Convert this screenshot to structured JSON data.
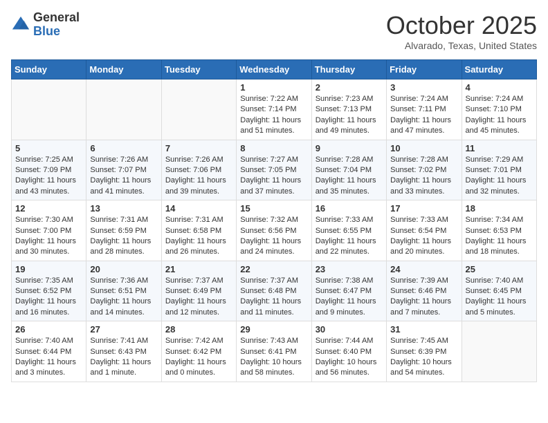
{
  "header": {
    "logo_general": "General",
    "logo_blue": "Blue",
    "month_title": "October 2025",
    "location": "Alvarado, Texas, United States"
  },
  "days_of_week": [
    "Sunday",
    "Monday",
    "Tuesday",
    "Wednesday",
    "Thursday",
    "Friday",
    "Saturday"
  ],
  "weeks": [
    [
      {
        "day": "",
        "content": ""
      },
      {
        "day": "",
        "content": ""
      },
      {
        "day": "",
        "content": ""
      },
      {
        "day": "1",
        "content": "Sunrise: 7:22 AM\nSunset: 7:14 PM\nDaylight: 11 hours and 51 minutes."
      },
      {
        "day": "2",
        "content": "Sunrise: 7:23 AM\nSunset: 7:13 PM\nDaylight: 11 hours and 49 minutes."
      },
      {
        "day": "3",
        "content": "Sunrise: 7:24 AM\nSunset: 7:11 PM\nDaylight: 11 hours and 47 minutes."
      },
      {
        "day": "4",
        "content": "Sunrise: 7:24 AM\nSunset: 7:10 PM\nDaylight: 11 hours and 45 minutes."
      }
    ],
    [
      {
        "day": "5",
        "content": "Sunrise: 7:25 AM\nSunset: 7:09 PM\nDaylight: 11 hours and 43 minutes."
      },
      {
        "day": "6",
        "content": "Sunrise: 7:26 AM\nSunset: 7:07 PM\nDaylight: 11 hours and 41 minutes."
      },
      {
        "day": "7",
        "content": "Sunrise: 7:26 AM\nSunset: 7:06 PM\nDaylight: 11 hours and 39 minutes."
      },
      {
        "day": "8",
        "content": "Sunrise: 7:27 AM\nSunset: 7:05 PM\nDaylight: 11 hours and 37 minutes."
      },
      {
        "day": "9",
        "content": "Sunrise: 7:28 AM\nSunset: 7:04 PM\nDaylight: 11 hours and 35 minutes."
      },
      {
        "day": "10",
        "content": "Sunrise: 7:28 AM\nSunset: 7:02 PM\nDaylight: 11 hours and 33 minutes."
      },
      {
        "day": "11",
        "content": "Sunrise: 7:29 AM\nSunset: 7:01 PM\nDaylight: 11 hours and 32 minutes."
      }
    ],
    [
      {
        "day": "12",
        "content": "Sunrise: 7:30 AM\nSunset: 7:00 PM\nDaylight: 11 hours and 30 minutes."
      },
      {
        "day": "13",
        "content": "Sunrise: 7:31 AM\nSunset: 6:59 PM\nDaylight: 11 hours and 28 minutes."
      },
      {
        "day": "14",
        "content": "Sunrise: 7:31 AM\nSunset: 6:58 PM\nDaylight: 11 hours and 26 minutes."
      },
      {
        "day": "15",
        "content": "Sunrise: 7:32 AM\nSunset: 6:56 PM\nDaylight: 11 hours and 24 minutes."
      },
      {
        "day": "16",
        "content": "Sunrise: 7:33 AM\nSunset: 6:55 PM\nDaylight: 11 hours and 22 minutes."
      },
      {
        "day": "17",
        "content": "Sunrise: 7:33 AM\nSunset: 6:54 PM\nDaylight: 11 hours and 20 minutes."
      },
      {
        "day": "18",
        "content": "Sunrise: 7:34 AM\nSunset: 6:53 PM\nDaylight: 11 hours and 18 minutes."
      }
    ],
    [
      {
        "day": "19",
        "content": "Sunrise: 7:35 AM\nSunset: 6:52 PM\nDaylight: 11 hours and 16 minutes."
      },
      {
        "day": "20",
        "content": "Sunrise: 7:36 AM\nSunset: 6:51 PM\nDaylight: 11 hours and 14 minutes."
      },
      {
        "day": "21",
        "content": "Sunrise: 7:37 AM\nSunset: 6:49 PM\nDaylight: 11 hours and 12 minutes."
      },
      {
        "day": "22",
        "content": "Sunrise: 7:37 AM\nSunset: 6:48 PM\nDaylight: 11 hours and 11 minutes."
      },
      {
        "day": "23",
        "content": "Sunrise: 7:38 AM\nSunset: 6:47 PM\nDaylight: 11 hours and 9 minutes."
      },
      {
        "day": "24",
        "content": "Sunrise: 7:39 AM\nSunset: 6:46 PM\nDaylight: 11 hours and 7 minutes."
      },
      {
        "day": "25",
        "content": "Sunrise: 7:40 AM\nSunset: 6:45 PM\nDaylight: 11 hours and 5 minutes."
      }
    ],
    [
      {
        "day": "26",
        "content": "Sunrise: 7:40 AM\nSunset: 6:44 PM\nDaylight: 11 hours and 3 minutes."
      },
      {
        "day": "27",
        "content": "Sunrise: 7:41 AM\nSunset: 6:43 PM\nDaylight: 11 hours and 1 minute."
      },
      {
        "day": "28",
        "content": "Sunrise: 7:42 AM\nSunset: 6:42 PM\nDaylight: 11 hours and 0 minutes."
      },
      {
        "day": "29",
        "content": "Sunrise: 7:43 AM\nSunset: 6:41 PM\nDaylight: 10 hours and 58 minutes."
      },
      {
        "day": "30",
        "content": "Sunrise: 7:44 AM\nSunset: 6:40 PM\nDaylight: 10 hours and 56 minutes."
      },
      {
        "day": "31",
        "content": "Sunrise: 7:45 AM\nSunset: 6:39 PM\nDaylight: 10 hours and 54 minutes."
      },
      {
        "day": "",
        "content": ""
      }
    ]
  ]
}
